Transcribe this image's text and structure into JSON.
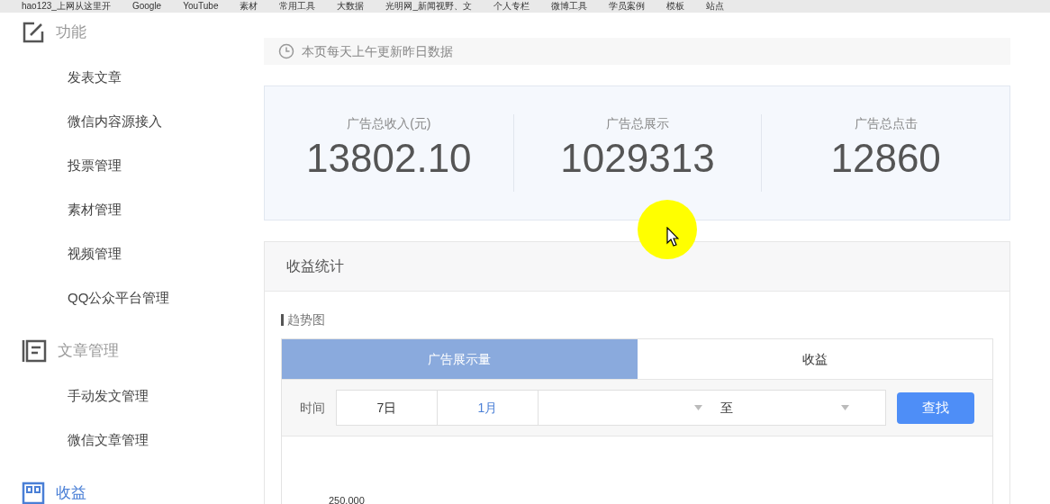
{
  "bookmarks": [
    {
      "label": "hao123_上网从这里开"
    },
    {
      "label": "Google"
    },
    {
      "label": "YouTube"
    },
    {
      "label": "素材"
    },
    {
      "label": "常用工具"
    },
    {
      "label": "大数据"
    },
    {
      "label": "光明网_新闻视野、文"
    },
    {
      "label": "个人专栏"
    },
    {
      "label": "微博工具"
    },
    {
      "label": "学员案例"
    },
    {
      "label": "模板"
    },
    {
      "label": "站点"
    }
  ],
  "sidebar": {
    "sections": [
      {
        "kind": "edit",
        "title": "功能",
        "selected": false,
        "items": [
          {
            "label": "发表文章"
          },
          {
            "label": "微信内容源接入"
          },
          {
            "label": "投票管理"
          },
          {
            "label": "素材管理"
          },
          {
            "label": "视频管理"
          },
          {
            "label": "QQ公众平台管理"
          }
        ]
      },
      {
        "kind": "doc",
        "title": "文章管理",
        "selected": false,
        "items": [
          {
            "label": "手动发文管理"
          },
          {
            "label": "微信文章管理"
          }
        ]
      },
      {
        "kind": "grid",
        "title": "收益",
        "selected": true
      }
    ]
  },
  "notice": "本页每天上午更新昨日数据",
  "stats": [
    {
      "label": "广告总收入(元)",
      "value": "13802.10"
    },
    {
      "label": "广告总展示",
      "value": "1029313"
    },
    {
      "label": "广告总点击",
      "value": "12860"
    }
  ],
  "earnings": {
    "title": "收益统计",
    "subtitle": "趋势图",
    "tabs": [
      {
        "label": "广告展示量",
        "selected": true
      },
      {
        "label": "收益",
        "selected": false
      }
    ],
    "filter": {
      "label": "时间",
      "ranges": [
        {
          "label": "7日",
          "selected": false
        },
        {
          "label": "1月",
          "selected": true
        }
      ],
      "separator": "至",
      "button": "查找"
    },
    "chart": {
      "y_label": "250,000"
    }
  }
}
